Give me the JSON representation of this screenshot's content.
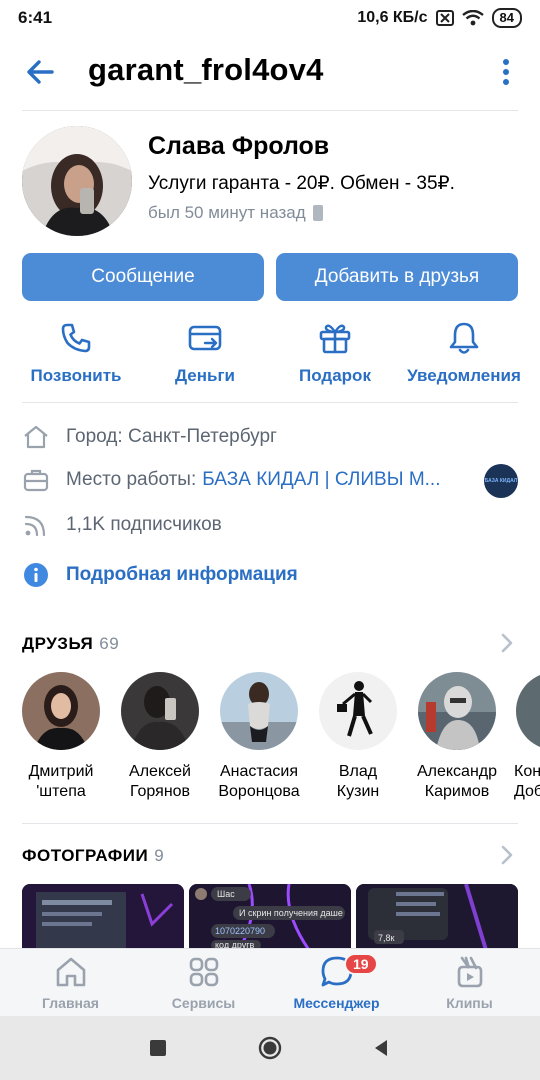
{
  "status_bar": {
    "time": "6:41",
    "net_speed": "10,6 КБ/с",
    "battery": "84"
  },
  "header": {
    "title": "garant_frol4ov4"
  },
  "profile": {
    "name": "Слава Фролов",
    "status": "Услуги гаранта - 20₽. Обмен - 35₽.",
    "last_seen": "был 50 минут назад"
  },
  "buttons": {
    "message": "Сообщение",
    "add_friend": "Добавить в друзья"
  },
  "actions": [
    {
      "label": "Позвонить",
      "icon": "phone-icon"
    },
    {
      "label": "Деньги",
      "icon": "money-icon"
    },
    {
      "label": "Подарок",
      "icon": "gift-icon"
    },
    {
      "label": "Уведомления",
      "icon": "bell-icon"
    }
  ],
  "info": {
    "city_label": "Город: Санкт-Петербург",
    "work_label": "Место работы:",
    "work_value": "БАЗА КИДАЛ | СЛИВЫ М...",
    "work_thumb_text": "БАЗА КИДАЛ",
    "followers": "1,1K подписчиков",
    "more": "Подробная информация"
  },
  "friends_section": {
    "title": "ДРУЗЬЯ",
    "count": "69",
    "items": [
      {
        "line1": "Дмитрий",
        "line2": "'штепа"
      },
      {
        "line1": "Алексей",
        "line2": "Горянов"
      },
      {
        "line1": "Анастасия",
        "line2": "Воронцова"
      },
      {
        "line1": "Влад",
        "line2": "Кузин"
      },
      {
        "line1": "Александр",
        "line2": "Каримов"
      },
      {
        "line1": "Кон",
        "line2": "Доб"
      }
    ]
  },
  "photos_section": {
    "title": "ФОТОГРАФИИ",
    "count": "9",
    "photo_texts": [
      "Шас",
      "И скрин получения даше",
      "1070220790",
      "код другв",
      "7,8к"
    ]
  },
  "tabs": [
    {
      "label": "Главная",
      "icon": "home-icon",
      "active": false
    },
    {
      "label": "Сервисы",
      "icon": "services-icon",
      "active": false
    },
    {
      "label": "Мессенджер",
      "icon": "messenger-icon",
      "active": true,
      "badge": "19"
    },
    {
      "label": "Клипы",
      "icon": "clips-icon",
      "active": false
    }
  ],
  "colors": {
    "accent": "#2a6fc4",
    "button": "#4c8bd6",
    "badge": "#e64646",
    "secondary_text": "#818c99"
  }
}
